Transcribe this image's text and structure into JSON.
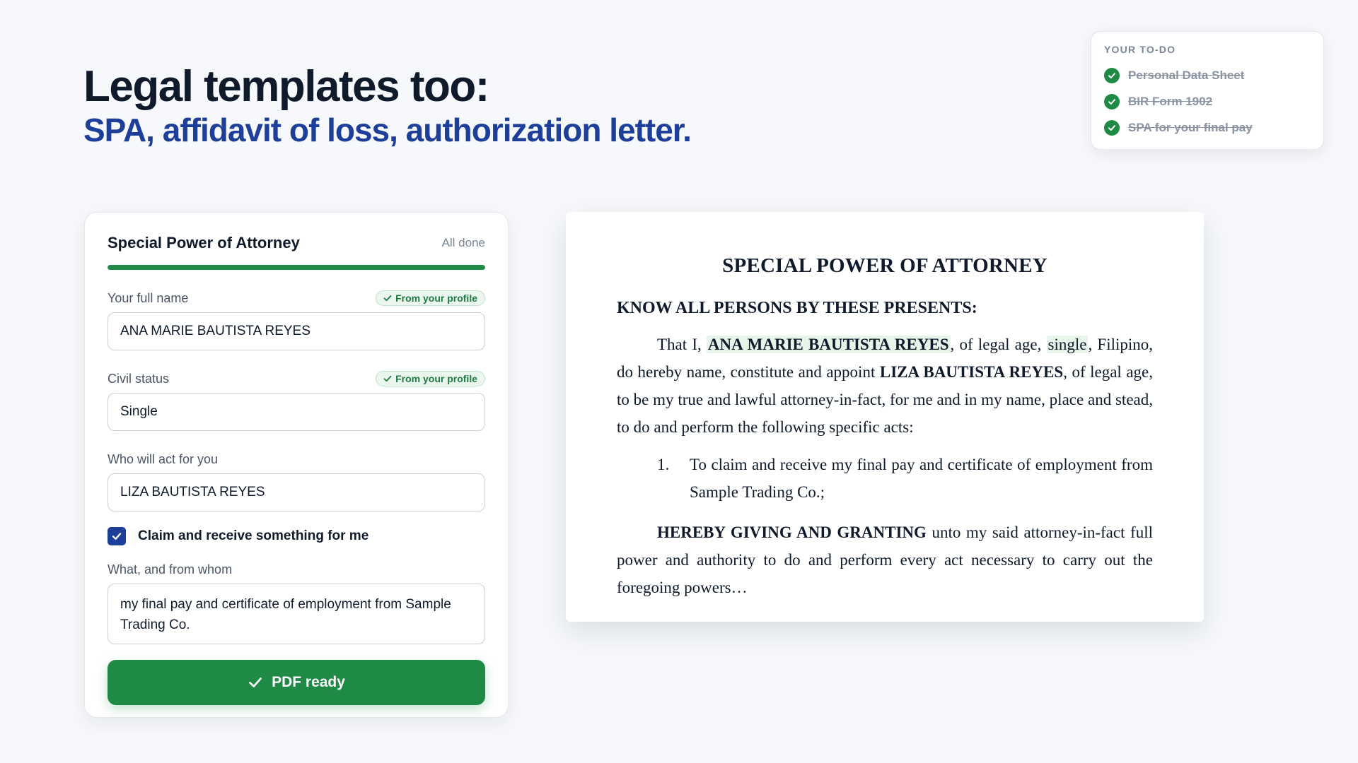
{
  "hero": {
    "title": "Legal templates too:",
    "subtitle": "SPA, affidavit of loss, authorization letter."
  },
  "todo": {
    "heading": "YOUR TO-DO",
    "items": [
      {
        "label": "Personal Data Sheet",
        "done": true
      },
      {
        "label": "BIR Form 1902",
        "done": true
      },
      {
        "label": "SPA for your final pay",
        "done": true
      }
    ]
  },
  "form": {
    "title": "Special Power of Attorney",
    "status": "All done",
    "progress": 1.0,
    "fields": {
      "full_name": {
        "label": "Your full name",
        "badge": "From your profile",
        "value": "ANA MARIE BAUTISTA REYES"
      },
      "civil_status": {
        "label": "Civil status",
        "badge": "From your profile",
        "value": "Single"
      },
      "agent": {
        "label": "Who will act for you",
        "value": "LIZA BAUTISTA REYES"
      },
      "claim": {
        "label": "Claim and receive something for me",
        "checked": true
      },
      "details": {
        "label": "What, and from whom",
        "value": "my final pay and certificate of employment from Sample Trading Co."
      }
    },
    "button_label": "PDF ready"
  },
  "document": {
    "title": "SPECIAL POWER OF ATTORNEY",
    "know": "KNOW ALL PERSONS BY THESE PRESENTS:",
    "p1": {
      "a": "That I, ",
      "principal": "ANA MARIE BAUTISTA REYES",
      "b": ", of legal age, ",
      "status": "single",
      "c": ", Filipino, do hereby name, constitute and appoint ",
      "agent": "LIZA BAUTISTA REYES",
      "d": ", of legal age, to be my true and lawful attorney-in-fact, for me and in my name, place and stead, to do and perform the following specific acts:"
    },
    "list": [
      {
        "num": "1.",
        "text": "To claim and receive my final pay and certificate of employment from Sample Trading Co.;"
      }
    ],
    "p2": {
      "lead": "HEREBY GIVING AND GRANTING",
      "rest": " unto my said attorney-in-fact full power and authority to do and perform every act necessary to carry out the foregoing powers…"
    }
  },
  "colors": {
    "accent_blue": "#1d3f9a",
    "success_green": "#1e8a45",
    "highlight": "#e7f4ea"
  },
  "icons": {
    "todo_check": "check-circle-icon",
    "badge_check": "check-icon",
    "checkbox": "checkbox-checked-icon",
    "button": "check-icon"
  }
}
